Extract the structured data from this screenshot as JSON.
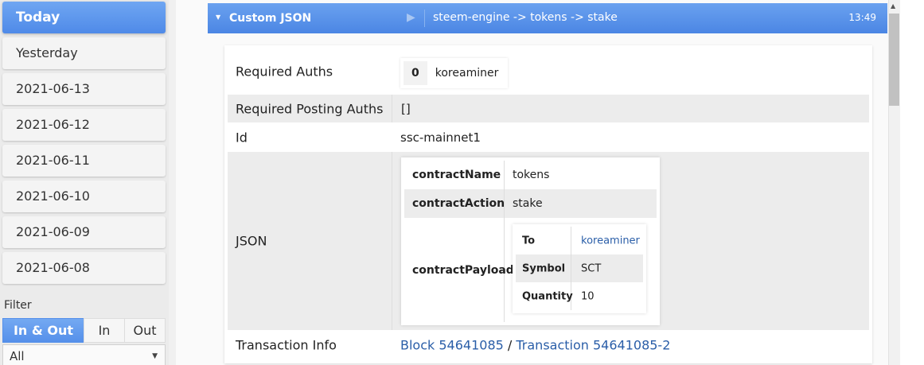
{
  "sidebar": {
    "days": [
      {
        "label": "Today",
        "active": true
      },
      {
        "label": "Yesterday",
        "active": false
      },
      {
        "label": "2021-06-13",
        "active": false
      },
      {
        "label": "2021-06-12",
        "active": false
      },
      {
        "label": "2021-06-11",
        "active": false
      },
      {
        "label": "2021-06-10",
        "active": false
      },
      {
        "label": "2021-06-09",
        "active": false
      },
      {
        "label": "2021-06-08",
        "active": false
      }
    ],
    "filter_label": "Filter",
    "direction": [
      "In & Out",
      "In",
      "Out"
    ],
    "direction_selected": "In & Out",
    "type_select": "All"
  },
  "operation": {
    "title": "Custom JSON",
    "path": "steem-engine -> tokens -> stake",
    "time": "13:49",
    "fields": {
      "required_auths_label": "Required Auths",
      "required_auths_index": "0",
      "required_auths_value": "koreaminer",
      "required_posting_label": "Required Posting Auths",
      "required_posting_value": "[]",
      "id_label": "Id",
      "id_value": "ssc-mainnet1",
      "json_label": "JSON",
      "tx_label": "Transaction Info",
      "block_link": "Block 54641085",
      "tx_sep": "/",
      "tx_link": "Transaction 54641085-2"
    },
    "json": {
      "contractName_key": "contractName",
      "contractName_val": "tokens",
      "contractAction_key": "contractAction",
      "contractAction_val": "stake",
      "contractPayload_key": "contractPayload",
      "payload": {
        "to_key": "To",
        "to_val": "koreaminer",
        "symbol_key": "Symbol",
        "symbol_val": "SCT",
        "quantity_key": "Quantity",
        "quantity_val": "10"
      }
    }
  },
  "colors": {
    "accent": "#4f8ae8",
    "link": "#2a5ea8"
  }
}
